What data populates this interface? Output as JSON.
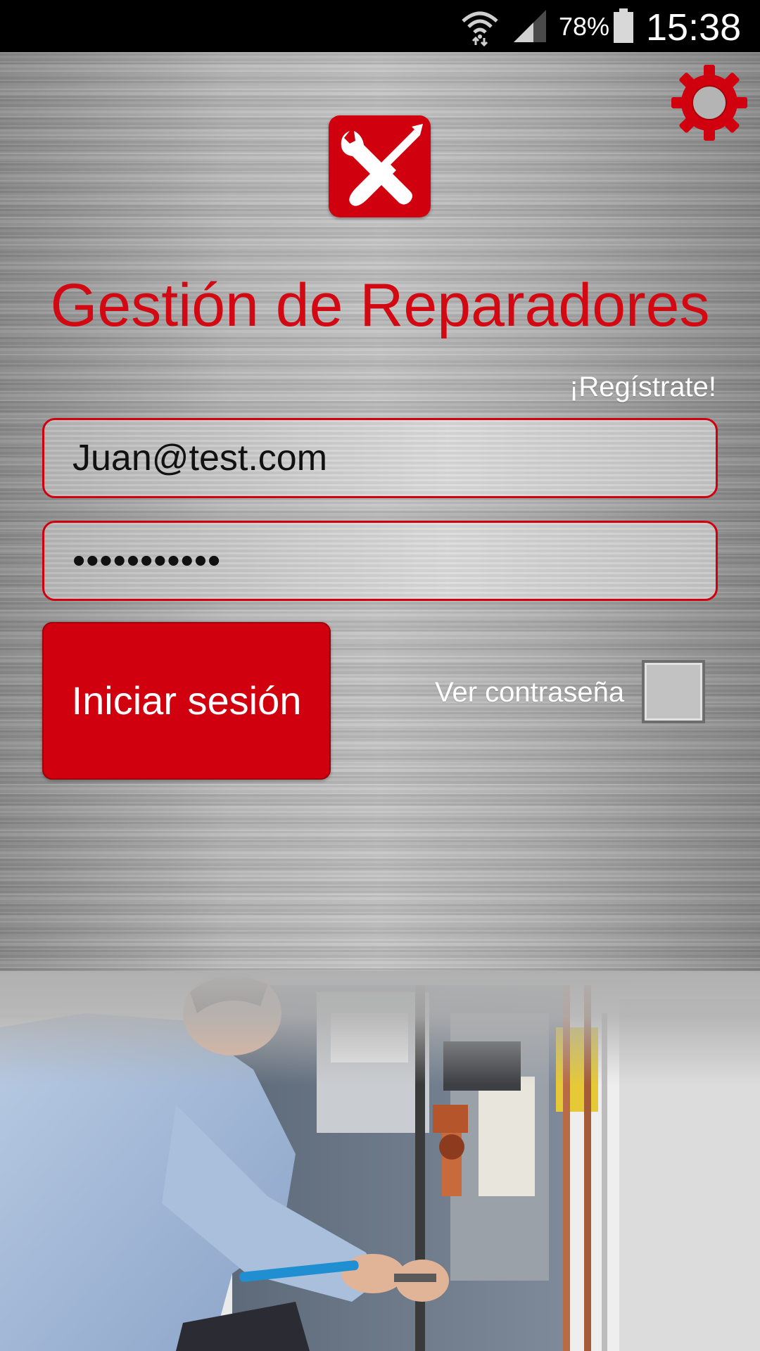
{
  "status_bar": {
    "battery_percent": "78%",
    "time": "15:38",
    "wifi_icon": "wifi-icon",
    "signal_icon": "cell-signal-icon",
    "battery_icon": "battery-icon"
  },
  "header": {
    "settings_icon": "gear-icon",
    "logo_icon": "wrench-screwdriver-icon",
    "title": "Gestión de Reparadores"
  },
  "form": {
    "register_link": "¡Regístrate!",
    "email_value": "Juan@test.com",
    "password_value": "•••••••••••",
    "login_button": "Iniciar sesión",
    "show_password_label": "Ver contraseña",
    "show_password_checked": false
  },
  "colors": {
    "brand_red": "#d0000e",
    "title_red": "#d20812"
  }
}
